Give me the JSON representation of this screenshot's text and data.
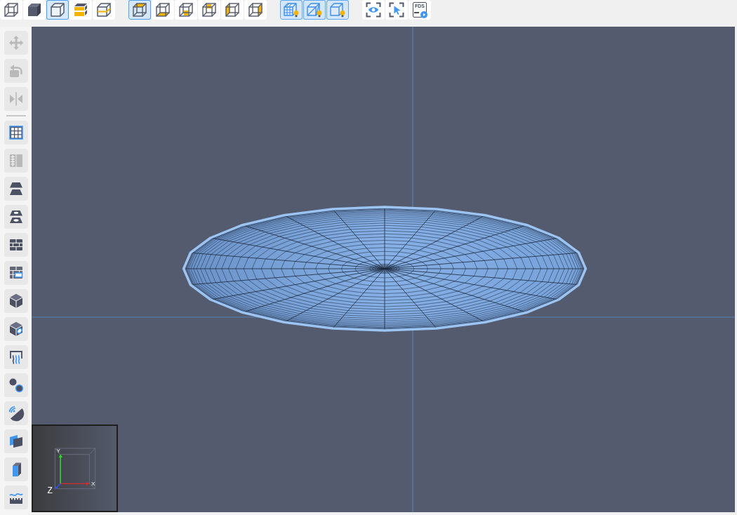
{
  "toolbar": {
    "view_modes": [
      {
        "selected": false
      },
      {
        "selected": false
      },
      {
        "selected": true
      },
      {
        "selected": false
      },
      {
        "selected": false
      }
    ],
    "view_directions": [
      {
        "selected": true
      },
      {
        "selected": false
      },
      {
        "selected": false
      },
      {
        "selected": false
      },
      {
        "selected": false
      },
      {
        "selected": false
      }
    ],
    "display_toggles": [
      {
        "on": true
      },
      {
        "on": true
      },
      {
        "on": true
      }
    ],
    "actions": {
      "fds_label": "FDS"
    }
  },
  "sidebar": {
    "transform_tools": [
      {
        "disabled": true
      },
      {
        "disabled": true
      },
      {
        "disabled": true
      }
    ],
    "model_tools": [
      {
        "disabled": false
      },
      {
        "disabled": true
      },
      {
        "disabled": false
      },
      {
        "disabled": false
      },
      {
        "disabled": false
      },
      {
        "disabled": false
      },
      {
        "disabled": false
      },
      {
        "disabled": false
      },
      {
        "disabled": false
      },
      {
        "disabled": false
      },
      {
        "disabled": false
      },
      {
        "disabled": false
      },
      {
        "disabled": false
      },
      {
        "disabled": false
      }
    ]
  },
  "viewport": {
    "axis_gizmo": {
      "x_label": "X",
      "y_label": "Y",
      "z_label": "Z"
    }
  }
}
